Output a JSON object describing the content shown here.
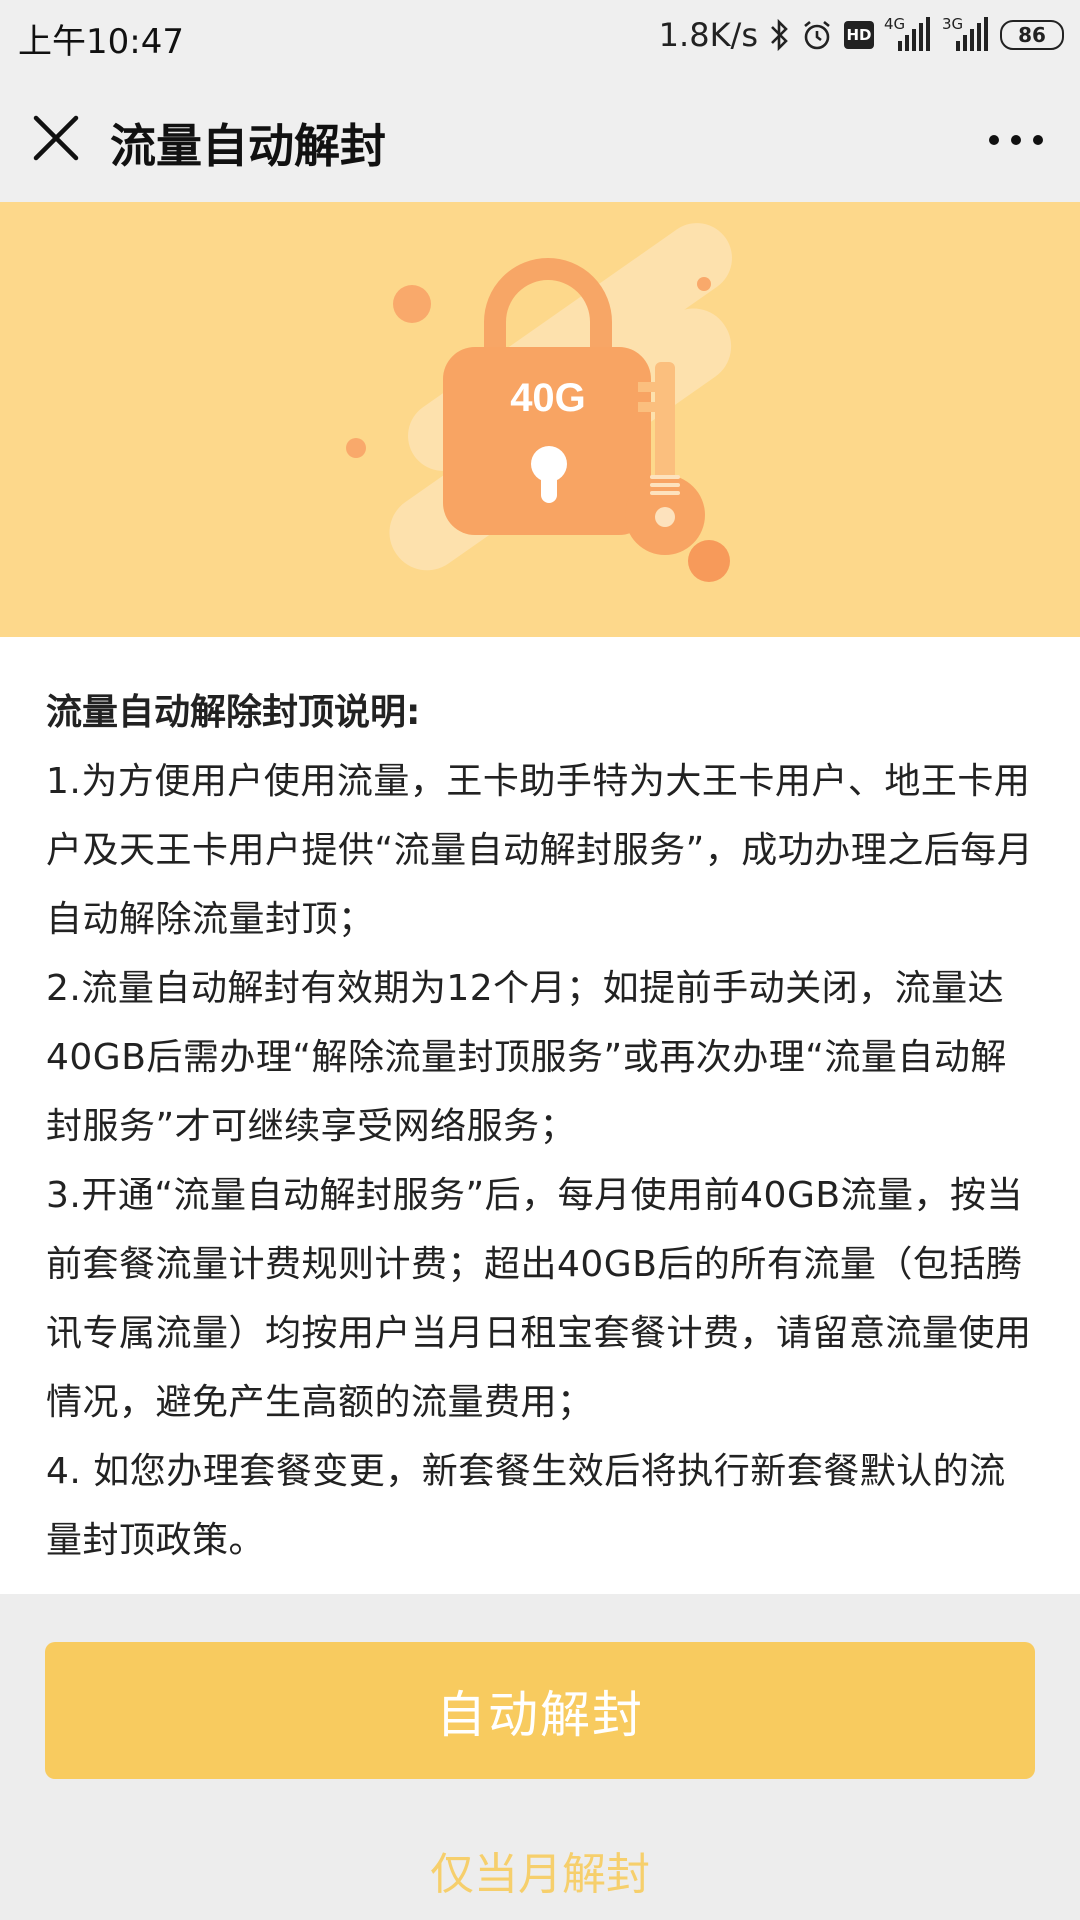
{
  "status_bar": {
    "time": "上午10:47",
    "speed": "1.8K/s",
    "battery": "86",
    "icons": [
      "bluetooth-icon",
      "alarm-icon",
      "hd-icon",
      "signal-4g-icon",
      "signal-3g-icon",
      "battery-icon"
    ],
    "network_a": "4G",
    "network_b": "3G",
    "hd": "HD"
  },
  "nav": {
    "title": "流量自动解封",
    "close_icon": "close-icon",
    "more_icon": "more-icon"
  },
  "banner": {
    "lock_label": "40G",
    "background": "#fdd88b",
    "accent": "#f7a15a"
  },
  "content": {
    "title": "流量自动解除封顶说明:",
    "items": [
      "1.为方便用户使用流量，王卡助手特为大王卡用户、地王卡用户及天王卡用户提供“流量自动解封服务”，成功办理之后每月自动解除流量封顶；",
      "2.流量自动解封有效期为12个月；如提前手动关闭，流量达40GB后需办理“解除流量封顶服务”或再次办理“流量自动解封服务”才可继续享受网络服务；",
      "3.开通“流量自动解封服务”后，每月使用前40GB流量，按当前套餐流量计费规则计费；超出40GB后的所有流量（包括腾讯专属流量）均按用户当月日租宝套餐计费，请留意流量使用情况，避免产生高额的流量费用；",
      "4. 如您办理套餐变更，新套餐生效后将执行新套餐默认的流量封顶政策。"
    ]
  },
  "actions": {
    "primary_label": "自动解封",
    "secondary_label": "仅当月解封",
    "primary_color": "#f8cb5f"
  }
}
